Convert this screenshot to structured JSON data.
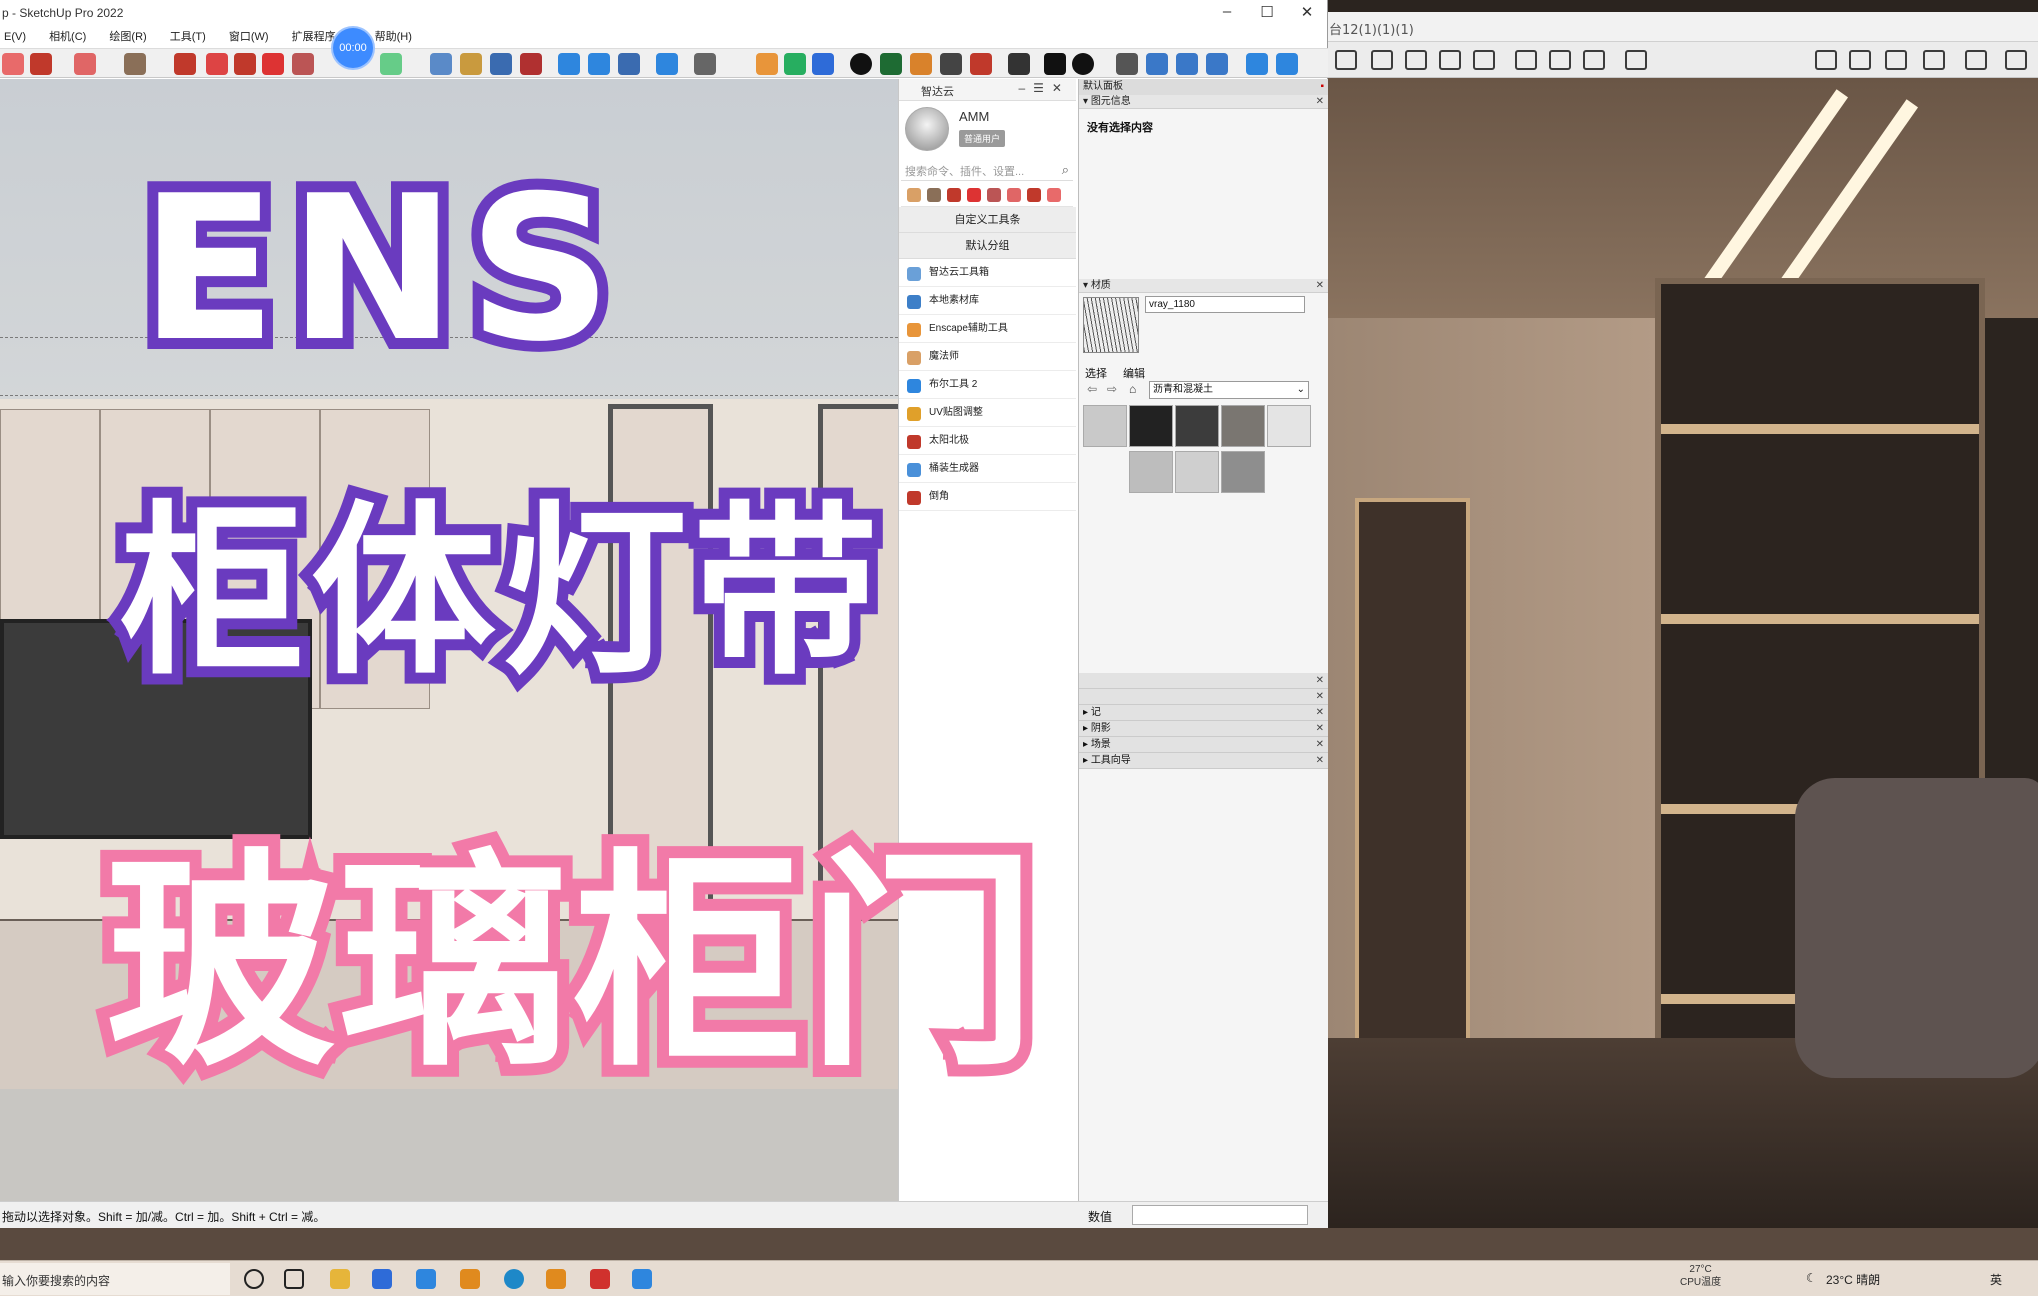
{
  "window": {
    "title": "p - SketchUp Pro 2022",
    "controls": [
      "–",
      "☐",
      "✕"
    ]
  },
  "menu": [
    "E(V)",
    "相机(C)",
    "绘图(R)",
    "工具(T)",
    "窗口(W)",
    "扩展程序 (x)",
    "帮助(H)"
  ],
  "timer": "00:00",
  "render_window": {
    "title": "台12(1)(1)(1)"
  },
  "plugin_panel": {
    "title": "智达云",
    "user_name": "AMM",
    "user_type": "普通用户",
    "search_placeholder": "搜索命令、插件、设置...",
    "section_custom": "自定义工具条",
    "section_default": "默认分组",
    "items": [
      {
        "label": "智达云工具箱",
        "color": "#6aa0d8"
      },
      {
        "label": "本地素材库",
        "color": "#3d7fc8"
      },
      {
        "label": "Enscape辅助工具",
        "color": "#e8953a"
      },
      {
        "label": "魔法师",
        "color": "#d9a066"
      },
      {
        "label": "布尔工具 2",
        "color": "#2e86de"
      },
      {
        "label": "UV贴图调整",
        "color": "#e0a02a"
      },
      {
        "label": "太阳北极",
        "color": "#c0392b"
      },
      {
        "label": "桶装生成器",
        "color": "#4a90d9"
      },
      {
        "label": "倒角",
        "color": "#c0392b"
      }
    ]
  },
  "tray": {
    "title": "默认面板",
    "entity_info": {
      "title": "图元信息",
      "text": "没有选择内容"
    },
    "materials": {
      "title": "材质",
      "name": "vray_1180",
      "tabs": [
        "选择",
        "编辑"
      ],
      "library": "沥青和混凝土",
      "swatch_colors": [
        "#c9c9c9",
        "#222222",
        "#3c3c3c",
        "#7a7671",
        "#e4e4e4",
        "#bdbdbd",
        "#cfcfcf",
        "#8e8e8e"
      ]
    },
    "collapsed_panels": [
      "记",
      "阴影",
      "场景",
      "工具向导"
    ]
  },
  "status": {
    "message": "拖动以选择对象。Shift = 加/减。Ctrl = 加。Shift + Ctrl = 减。",
    "value_label": "数值",
    "value": ""
  },
  "overlay": {
    "line1": "ENS",
    "line2": "柜体灯带",
    "line3": "玻璃柜门",
    "colors": {
      "purple": "#6a3bbf",
      "pink": "#f27aa8"
    }
  },
  "taskbar": {
    "search_text": "输入你要搜索的内容",
    "cpu_temp": "27°C",
    "cpu_label": "CPU温度",
    "weather": "23°C 晴朗",
    "ime": "英"
  }
}
